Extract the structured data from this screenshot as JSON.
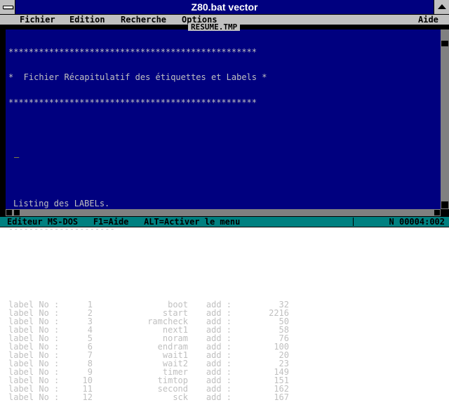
{
  "window": {
    "title": "Z80.bat vector"
  },
  "menu": {
    "items": [
      "Fichier",
      "Edition",
      "Recherche",
      "Options"
    ],
    "help": "Aide"
  },
  "document": {
    "title": "RESUME.TMP",
    "banner_top": "*************************************************",
    "banner_text": "*  Fichier Récapitulatif des étiquettes et Labels *",
    "banner_bottom": "*************************************************",
    "cursor_mark": "_",
    "section_title": "Listing des LABELs.",
    "section_rule": "---------------------",
    "labels": [
      {
        "text": "label No :",
        "num": "1",
        "name": "boot",
        "add": "add :",
        "val": "32"
      },
      {
        "text": "label No :",
        "num": "2",
        "name": "start",
        "add": "add :",
        "val": "2216"
      },
      {
        "text": "label No :",
        "num": "3",
        "name": "ramcheck",
        "add": "add :",
        "val": "50"
      },
      {
        "text": "label No :",
        "num": "4",
        "name": "next1",
        "add": "add :",
        "val": "58"
      },
      {
        "text": "label No :",
        "num": "5",
        "name": "noram",
        "add": "add :",
        "val": "76"
      },
      {
        "text": "label No :",
        "num": "6",
        "name": "endram",
        "add": "add :",
        "val": "100"
      },
      {
        "text": "label No :",
        "num": "7",
        "name": "wait1",
        "add": "add :",
        "val": "20"
      },
      {
        "text": "label No :",
        "num": "8",
        "name": "wait2",
        "add": "add :",
        "val": "23"
      },
      {
        "text": "label No :",
        "num": "9",
        "name": "timer",
        "add": "add :",
        "val": "149"
      },
      {
        "text": "label No :",
        "num": "10",
        "name": "timtop",
        "add": "add :",
        "val": "151"
      },
      {
        "text": "label No :",
        "num": "11",
        "name": "second",
        "add": "add :",
        "val": "162"
      },
      {
        "text": "label No :",
        "num": "12",
        "name": "sck",
        "add": "add :",
        "val": "167"
      }
    ]
  },
  "status": {
    "left": "Editeur MS-DOS   F1=Aide   ALT=Activer le menu",
    "right": "N 00004:002"
  }
}
